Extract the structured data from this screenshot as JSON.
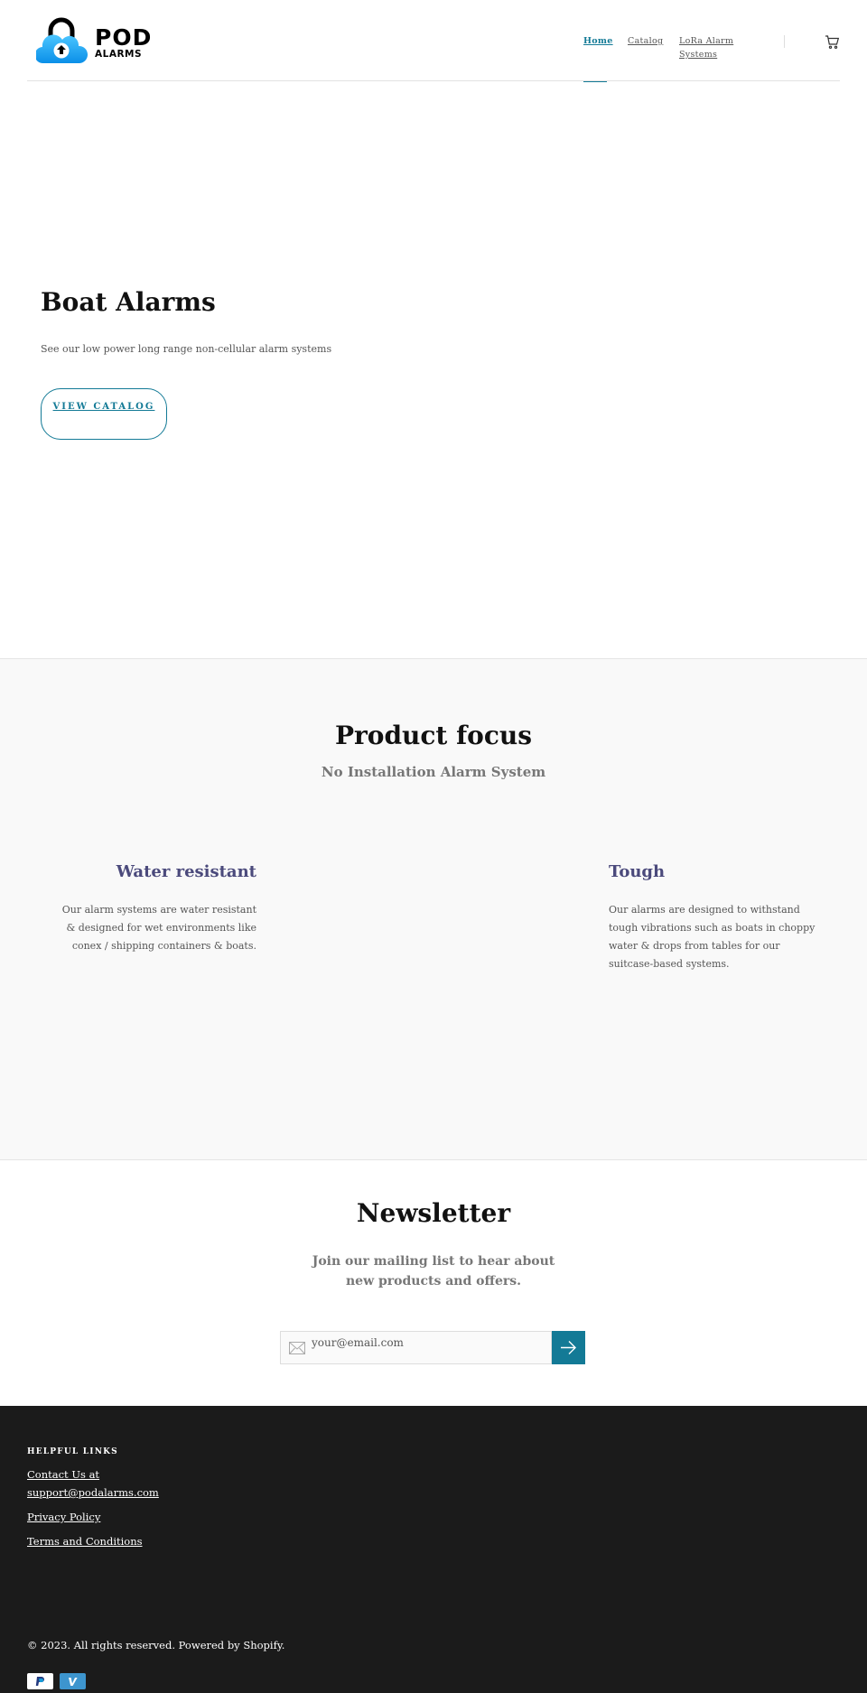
{
  "header": {
    "logo": {
      "line1": "POD",
      "line2": "ALARMS"
    },
    "nav": [
      {
        "label": "Home"
      },
      {
        "label": "Catalog"
      },
      {
        "label": "LoRa Alarm Systems"
      }
    ],
    "cart_icon": "cart-icon"
  },
  "hero": {
    "title": "Boat Alarms",
    "subtitle": "See our low power long range non-cellular alarm systems",
    "button_label": "VIEW CATALOG"
  },
  "product_focus": {
    "title": "Product focus",
    "subtitle": "No Installation Alarm System",
    "features": [
      {
        "title": "Water resistant",
        "body": "Our alarm systems are water resistant & designed for wet environments like conex / shipping containers & boats."
      },
      {
        "title": "Tough",
        "body": "Our alarms are designed to withstand tough vibrations such as boats in choppy water & drops from tables for our suitcase-based systems."
      }
    ]
  },
  "newsletter": {
    "title": "Newsletter",
    "subtitle": "Join our mailing list to hear about new products and offers.",
    "email_placeholder": "your@email.com",
    "mail_icon": "mail-icon",
    "submit_icon": "arrow-right-icon"
  },
  "footer": {
    "heading": "HELPFUL LINKS",
    "links": [
      {
        "label": "Contact Us at support@podalarms.com"
      },
      {
        "label": "Privacy Policy"
      },
      {
        "label": "Terms and Conditions"
      }
    ],
    "copyright": "© 2023. All rights reserved. Powered by Shopify.",
    "payment_icons": [
      "paypal-icon",
      "venmo-icon"
    ]
  },
  "colors": {
    "accent": "#137a96",
    "feature_title": "#4b4a7c",
    "footer_bg": "#1b1b1b",
    "section_bg": "#f9f9f9"
  }
}
